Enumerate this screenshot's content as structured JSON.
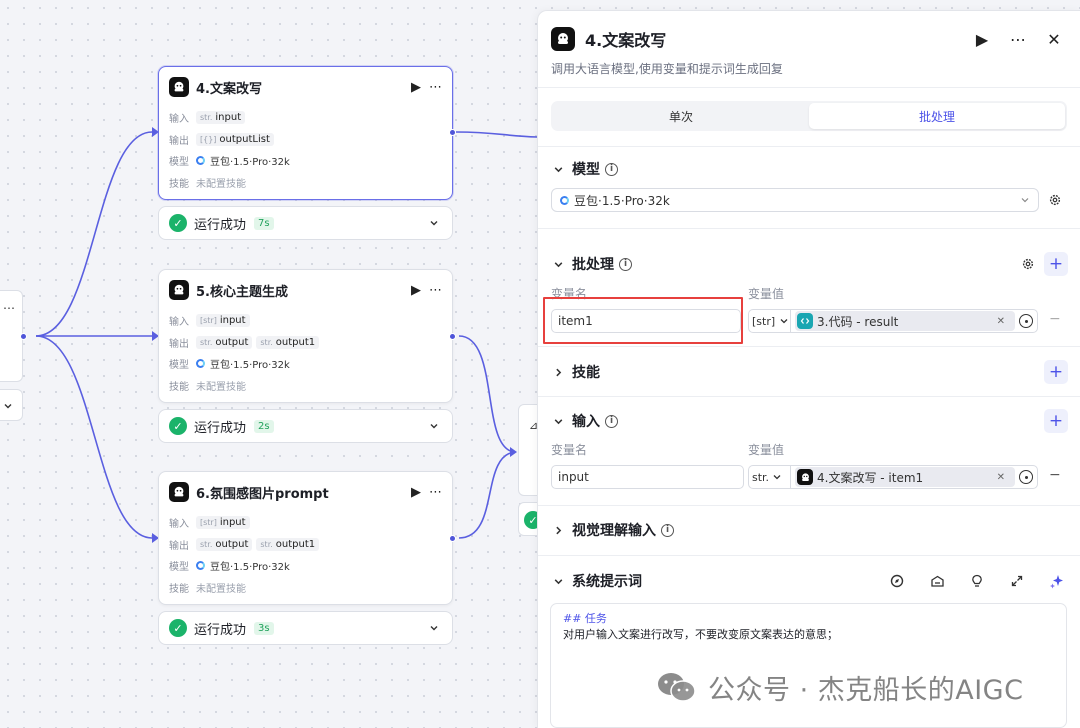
{
  "nodes": [
    {
      "title": "4.文案改写",
      "rows": [
        {
          "label": "输入",
          "chips": [
            {
              "type": "str.",
              "text": "input"
            }
          ]
        },
        {
          "label": "输出",
          "chips": [
            {
              "type": "[{}]",
              "text": "outputList"
            }
          ]
        },
        {
          "label": "模型",
          "model": "豆包·1.5·Pro·32k"
        },
        {
          "label": "技能",
          "muted": "未配置技能"
        }
      ],
      "status": "运行成功",
      "time": "7s"
    },
    {
      "title": "5.核心主题生成",
      "rows": [
        {
          "label": "输入",
          "chips": [
            {
              "type": "[str]",
              "text": "input"
            }
          ]
        },
        {
          "label": "输出",
          "chips": [
            {
              "type": "str.",
              "text": "output"
            },
            {
              "type": "str.",
              "text": "output1"
            }
          ]
        },
        {
          "label": "模型",
          "model": "豆包·1.5·Pro·32k"
        },
        {
          "label": "技能",
          "muted": "未配置技能"
        }
      ],
      "status": "运行成功",
      "time": "2s"
    },
    {
      "title": "6.氛围感图片prompt",
      "rows": [
        {
          "label": "输入",
          "chips": [
            {
              "type": "[str]",
              "text": "input"
            }
          ]
        },
        {
          "label": "输出",
          "chips": [
            {
              "type": "str.",
              "text": "output"
            },
            {
              "type": "str.",
              "text": "output1"
            }
          ]
        },
        {
          "label": "模型",
          "model": "豆包·1.5·Pro·32k"
        },
        {
          "label": "技能",
          "muted": "未配置技能"
        }
      ],
      "status": "运行成功",
      "time": "3s"
    }
  ],
  "panel": {
    "title": "4.文案改写",
    "description": "调用大语言模型,使用变量和提示词生成回复",
    "tabs": [
      "单次",
      "批处理"
    ],
    "active_tab": "批处理",
    "model_section": {
      "title": "模型",
      "value": "豆包·1.5·Pro·32k"
    },
    "batch_section": {
      "title": "批处理",
      "col_name": "变量名",
      "col_value": "变量值",
      "var_name": "item1",
      "var_type": "[str]",
      "ref_text": "3.代码 - result"
    },
    "skills_section": {
      "title": "技能"
    },
    "input_section": {
      "title": "输入",
      "col_name": "变量名",
      "col_value": "变量值",
      "var_name": "input",
      "var_type": "str.",
      "ref_text": "4.文案改写 - item1"
    },
    "vision_section": {
      "title": "视觉理解输入"
    },
    "prompt_section": {
      "title": "系统提示词",
      "heading": "## 任务",
      "text": "对用户输入文案进行改写，不要改变原文案表达的意思；"
    }
  },
  "watermark": "公众号 · 杰克船长的AIGC",
  "colors": {
    "accent": "#4d53e8",
    "edge": "#5a5fe0",
    "success": "#1bb36a",
    "highlight": "#e7403d"
  }
}
